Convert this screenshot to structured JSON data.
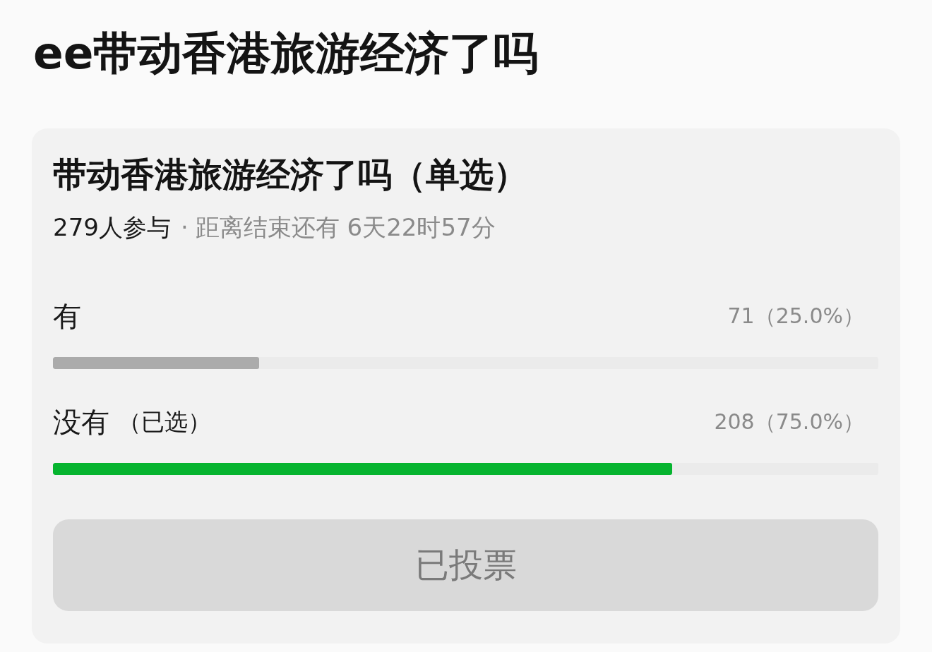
{
  "page_title": "ee带动香港旅游经济了吗",
  "poll": {
    "question": "带动香港旅游经济了吗（单选）",
    "participants": "279人参与",
    "separator": "·",
    "deadline": "距离结束还有 6天22时57分",
    "options": [
      {
        "label": "有",
        "selected": false,
        "result": "71（25.0%）",
        "level": 0.25
      },
      {
        "label": "没有",
        "selected": true,
        "tag": "（已选）",
        "result": "208（75.0%）",
        "level": 0.75
      }
    ],
    "vote_button": {
      "label": "已投票",
      "disabled": true
    }
  }
}
